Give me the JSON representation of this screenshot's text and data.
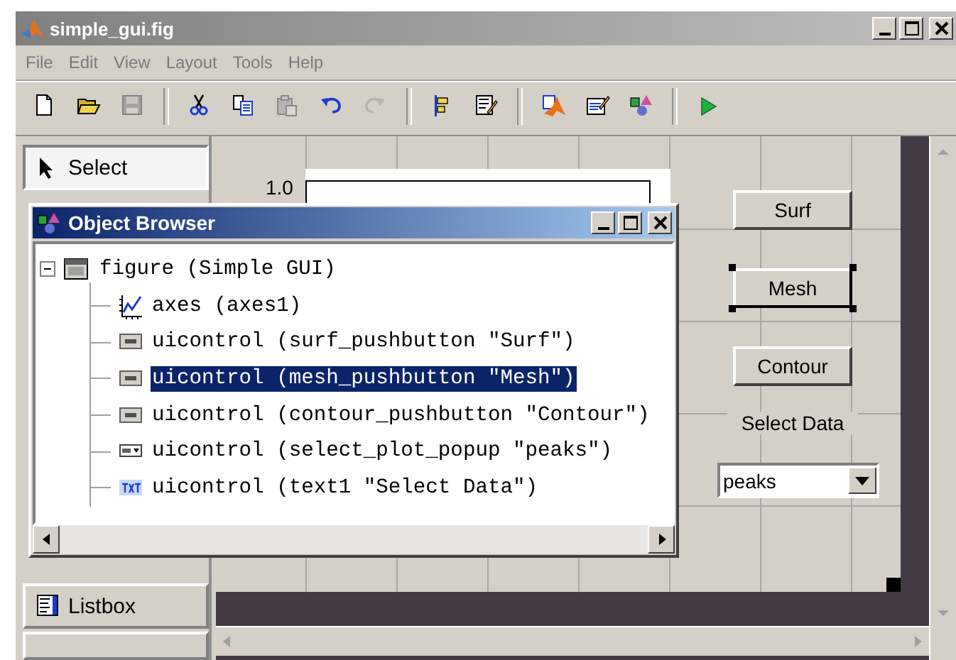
{
  "window": {
    "title": "simple_gui.fig"
  },
  "menu": [
    "File",
    "Edit",
    "View",
    "Layout",
    "Tools",
    "Help"
  ],
  "toolbar": [
    {
      "kind": "new",
      "disabled": false
    },
    {
      "kind": "open",
      "disabled": false
    },
    {
      "kind": "save",
      "disabled": true
    },
    {
      "kind": "separator"
    },
    {
      "kind": "cut",
      "disabled": false
    },
    {
      "kind": "copy",
      "disabled": false
    },
    {
      "kind": "paste",
      "disabled": true
    },
    {
      "kind": "undo",
      "disabled": false
    },
    {
      "kind": "redo",
      "disabled": true
    },
    {
      "kind": "separator"
    },
    {
      "kind": "align",
      "disabled": false
    },
    {
      "kind": "menu_editor",
      "disabled": false
    },
    {
      "kind": "separator"
    },
    {
      "kind": "inspector",
      "disabled": false
    },
    {
      "kind": "editor",
      "disabled": false
    },
    {
      "kind": "browser",
      "disabled": false
    },
    {
      "kind": "separator"
    },
    {
      "kind": "run",
      "disabled": false
    }
  ],
  "palette": [
    {
      "label": "Select",
      "kind": "select",
      "selected": true
    },
    {
      "label": "Listbox",
      "kind": "listbox",
      "selected": false
    }
  ],
  "canvas": {
    "axes_tick": "1.0",
    "buttons": [
      {
        "label": "Surf",
        "selected": false
      },
      {
        "label": "Mesh",
        "selected": true
      },
      {
        "label": "Contour",
        "selected": false
      }
    ],
    "text": "Select Data",
    "popup": {
      "value": "peaks"
    }
  },
  "object_browser": {
    "title": "Object Browser",
    "tree": [
      {
        "label": "figure (Simple GUI)",
        "kind": "figure",
        "expanded": true,
        "selected": false,
        "children": [
          {
            "label": "axes (axes1)",
            "kind": "axes",
            "selected": false
          },
          {
            "label": "uicontrol (surf_pushbutton \"Surf\")",
            "kind": "pushbutton",
            "selected": false
          },
          {
            "label": "uicontrol (mesh_pushbutton \"Mesh\")",
            "kind": "pushbutton",
            "selected": true
          },
          {
            "label": "uicontrol (contour_pushbutton \"Contour\")",
            "kind": "pushbutton",
            "selected": false
          },
          {
            "label": "uicontrol (select_plot_popup \"peaks\")",
            "kind": "popup",
            "selected": false
          },
          {
            "label": "uicontrol (text1 \"Select Data\")",
            "kind": "text",
            "selected": false
          }
        ]
      }
    ]
  }
}
